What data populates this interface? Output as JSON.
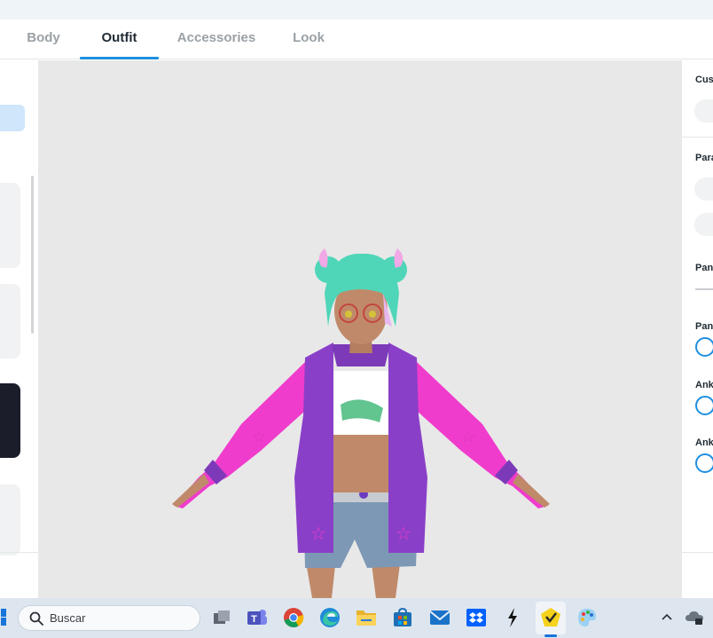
{
  "tabs": [
    {
      "label": "Body",
      "active": false
    },
    {
      "label": "Outfit",
      "active": true
    },
    {
      "label": "Accessories",
      "active": false
    },
    {
      "label": "Look",
      "active": false
    }
  ],
  "right_panel": {
    "labels": [
      "Cus",
      "Para",
      "Pan",
      "Pan",
      "Ank",
      "Ank"
    ]
  },
  "taskbar": {
    "search_placeholder": "Buscar",
    "apps": [
      "task-view",
      "teams",
      "chrome",
      "edge",
      "file-explorer",
      "microsoft-store",
      "mail",
      "dropbox",
      "bolt-app",
      "vroid-app",
      "paint"
    ]
  },
  "colors": {
    "accent": "#1e8fe0",
    "viewport_bg": "#e8e8e8",
    "hair": "#4fd6b8",
    "jacket_purple": "#8a3fc8",
    "jacket_pink": "#f03ccc",
    "shorts": "#7d98b5"
  }
}
